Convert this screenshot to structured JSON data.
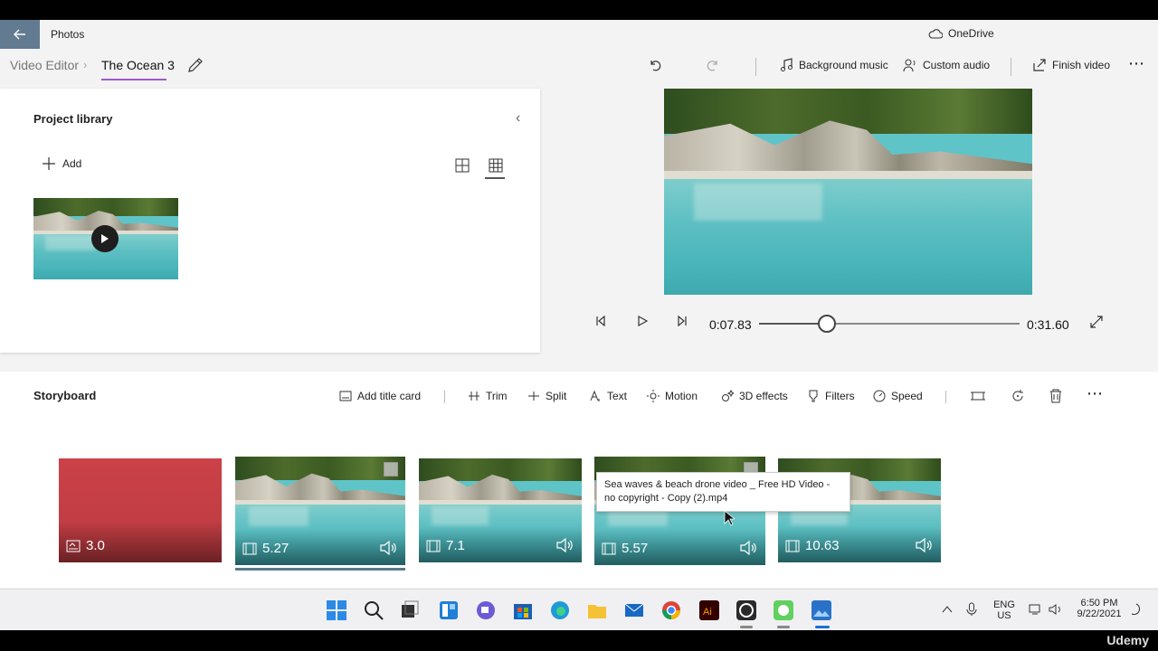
{
  "titlebar": {
    "app_title": "Photos",
    "onedrive_label": "OneDrive"
  },
  "cmdbar": {
    "breadcrumb_root": "Video Editor",
    "breadcrumb_current": "The Ocean 3",
    "background_music": "Background music",
    "custom_audio": "Custom audio",
    "finish_video": "Finish video"
  },
  "library": {
    "title": "Project library",
    "add_label": "Add"
  },
  "player": {
    "current_time": "0:07.83",
    "total_time": "0:31.60",
    "progress": 0.262
  },
  "storyboard": {
    "title": "Storyboard",
    "tools": {
      "add_title_card": "Add title card",
      "trim": "Trim",
      "split": "Split",
      "text": "Text",
      "motion": "Motion",
      "effects_3d": "3D effects",
      "filters": "Filters",
      "speed": "Speed"
    },
    "clips": [
      {
        "type": "title-card",
        "duration": "3.0"
      },
      {
        "type": "video",
        "duration": "5.27",
        "selected": true
      },
      {
        "type": "video",
        "duration": "7.1"
      },
      {
        "type": "video",
        "duration": "5.57"
      },
      {
        "type": "video",
        "duration": "10.63"
      }
    ],
    "tooltip": "Sea waves & beach drone video _ Free HD Video - no copyright - Copy (2).mp4"
  },
  "taskbar": {
    "lang": "ENG",
    "region": "US",
    "time": "6:50 PM",
    "date": "9/22/2021"
  },
  "watermark": "Udemy",
  "colors": {
    "accent_underline": "#9f59c8",
    "title_card": "#c23e44",
    "back_button": "#637b91"
  }
}
